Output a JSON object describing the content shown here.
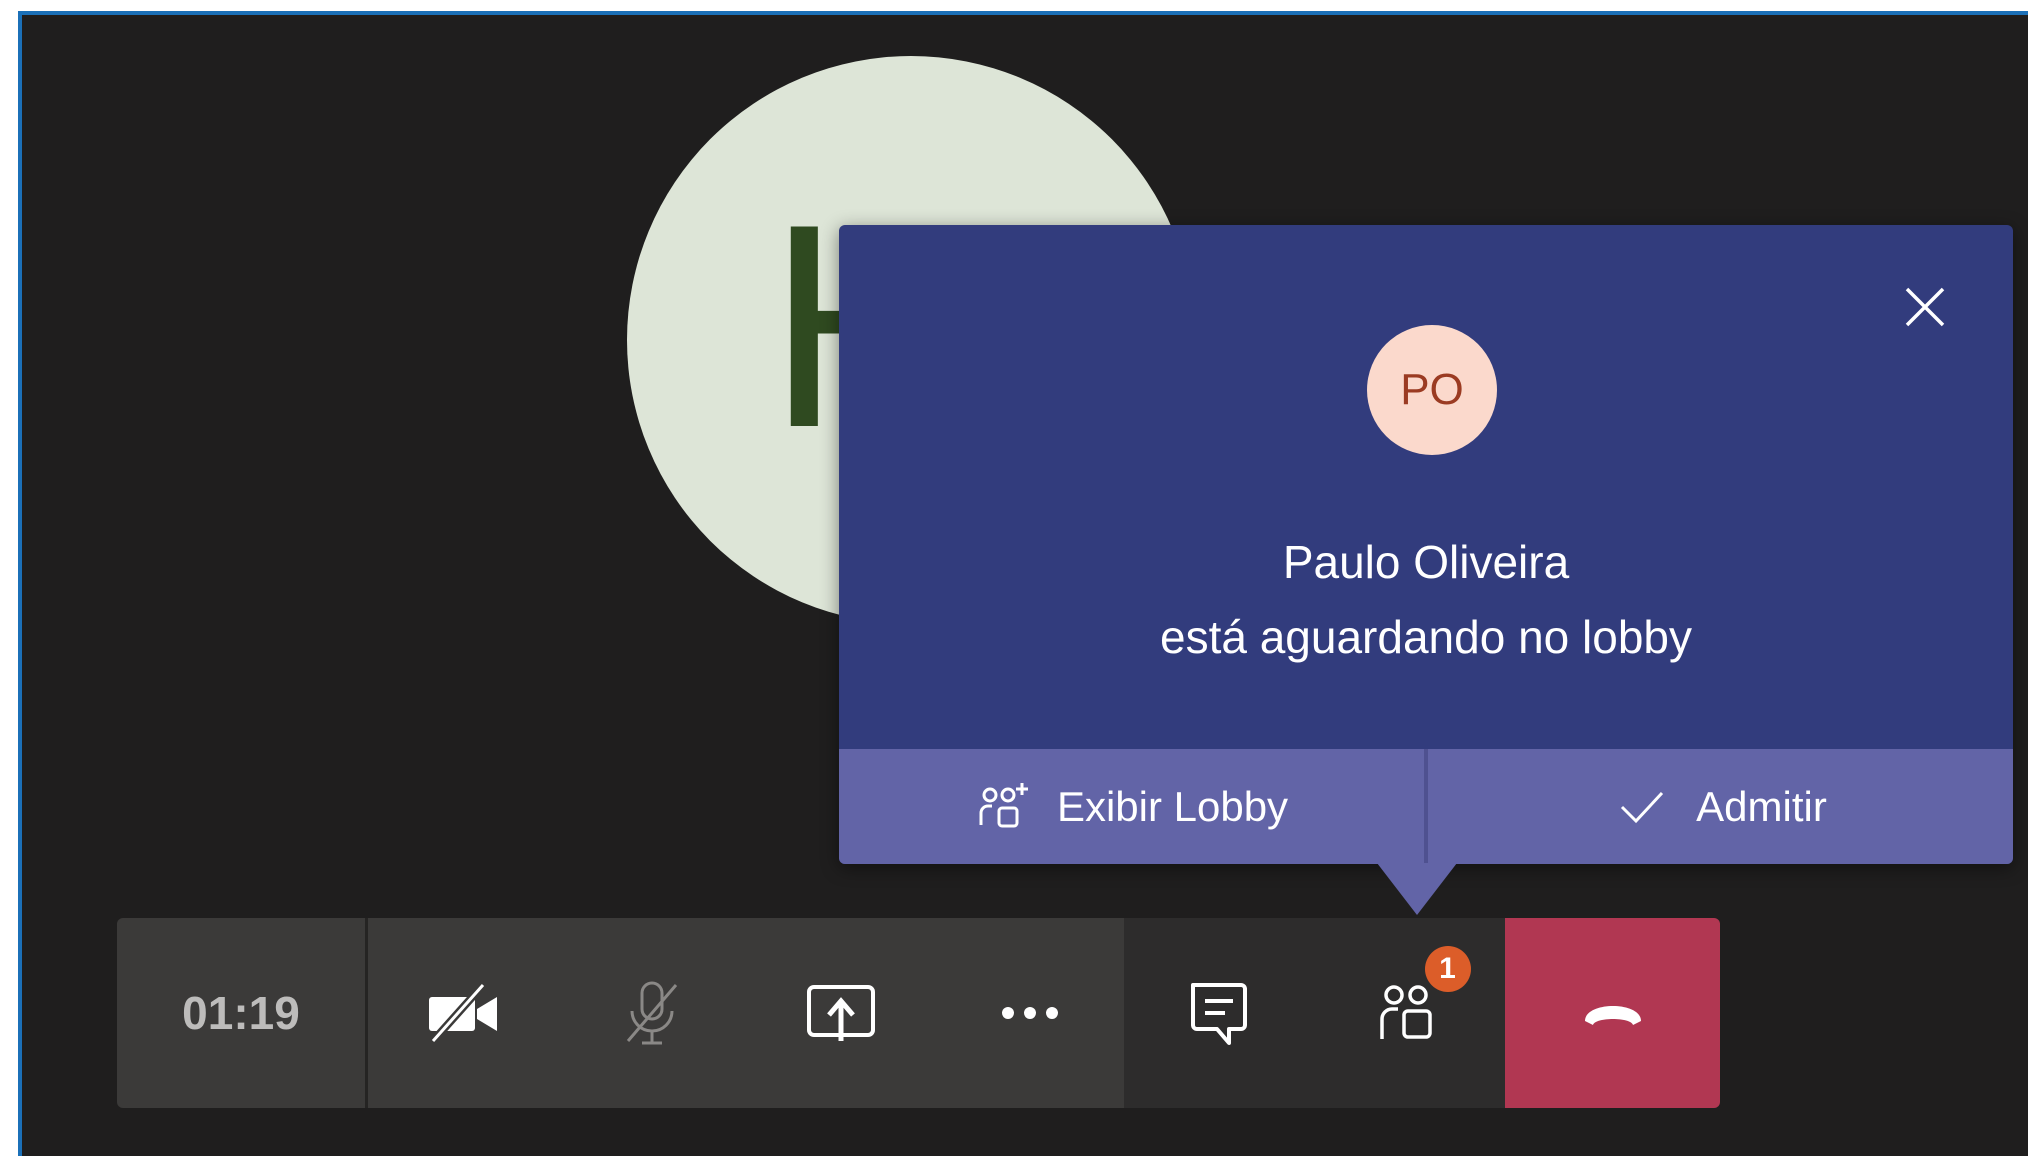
{
  "meeting": {
    "participant_initial": "H",
    "timer": "01:19"
  },
  "lobby_popup": {
    "avatar_initials": "PO",
    "name": "Paulo Oliveira",
    "message": "está aguardando no lobby",
    "view_lobby_label": "Exibir Lobby",
    "admit_label": "Admitir"
  },
  "toolbar": {
    "buttons": [
      {
        "icon": "camera-off-icon"
      },
      {
        "icon": "mic-off-icon"
      },
      {
        "icon": "share-screen-icon"
      },
      {
        "icon": "more-options-icon"
      },
      {
        "icon": "chat-icon"
      },
      {
        "icon": "participants-icon",
        "badge": "1"
      },
      {
        "icon": "hang-up-icon"
      }
    ]
  },
  "colors": {
    "background": "#1f1e1e",
    "popup": "#323c7d",
    "popup_actions": "#6264a7",
    "hangup": "#b13752",
    "badge": "#dc5d29",
    "frame_border": "#1b70b8"
  }
}
